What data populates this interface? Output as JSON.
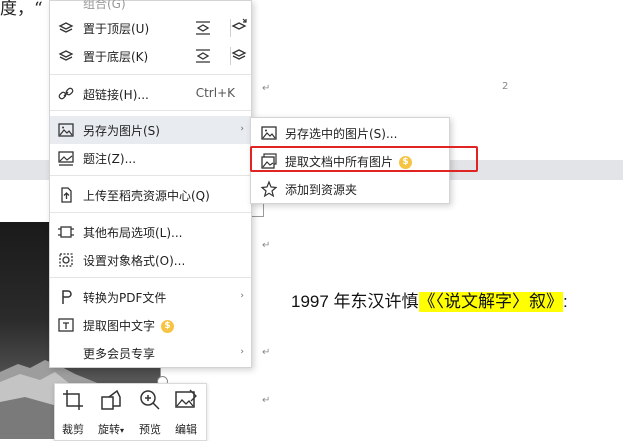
{
  "document": {
    "top_text": "度，“",
    "page_number": "2",
    "body_line_prefix": "1997 年东汉许慎",
    "body_line_highlight": "《〈说文解字〉叙》",
    "body_line_suffix": ":",
    "paragraph_mark": "↵",
    "highlight_color": "#ffff00"
  },
  "context_menu": {
    "items": [
      {
        "label": "组合(G)",
        "icon": "group-icon"
      },
      {
        "label": "置于顶层(U)",
        "icon": "bring-to-front-icon"
      },
      {
        "label": "置于底层(K)",
        "icon": "send-to-back-icon"
      },
      {
        "label": "超链接(H)...",
        "shortcut": "Ctrl+K",
        "icon": "hyperlink-icon"
      },
      {
        "label": "另存为图片(S)",
        "icon": "save-as-image-icon",
        "has_submenu": true
      },
      {
        "label": "题注(Z)...",
        "icon": "caption-icon"
      },
      {
        "label": "上传至稻壳资源中心(Q)",
        "icon": "upload-icon"
      },
      {
        "label": "其他布局选项(L)...",
        "icon": "layout-options-icon"
      },
      {
        "label": "设置对象格式(O)...",
        "icon": "format-object-icon"
      },
      {
        "label": "转换为PDF文件",
        "icon": "pdf-convert-icon",
        "has_submenu": true
      },
      {
        "label": "提取图中文字",
        "icon": "extract-text-icon",
        "vip": true
      },
      {
        "label": "更多会员专享",
        "icon": "",
        "has_submenu": true
      }
    ]
  },
  "submenu": {
    "items": [
      {
        "label": "另存选中的图片(S)...",
        "icon": "save-selected-image-icon"
      },
      {
        "label": "提取文档中所有图片",
        "icon": "extract-all-images-icon",
        "vip": true
      },
      {
        "label": "添加到资源夹",
        "icon": "add-to-favorites-icon"
      }
    ]
  },
  "image_toolbar": {
    "crop": "裁剪",
    "rotate": "旋转",
    "rotate_arrow": "▾",
    "preview": "预览",
    "edit": "编辑"
  },
  "colors": {
    "highlight_box": "#e02424",
    "vip_badge": "#f6c343"
  },
  "icons": {
    "submenu_arrow": "›",
    "vip_symbol": "$"
  }
}
